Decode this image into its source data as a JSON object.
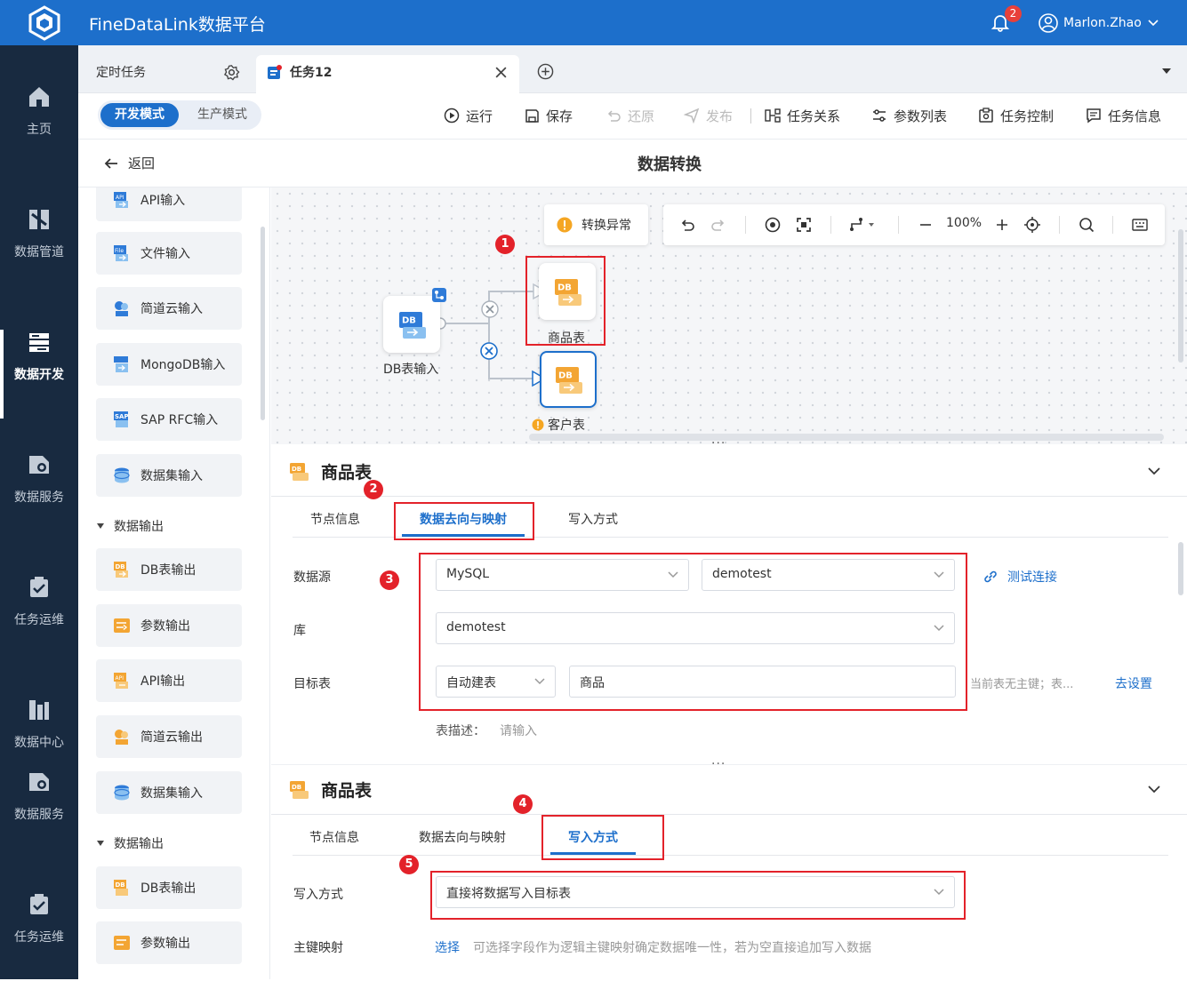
{
  "app": {
    "title": "FineDataLink数据平台",
    "notif_count": "2",
    "user": "Marlon.Zhao"
  },
  "nav": [
    {
      "label": "主页",
      "icon": "home-icon"
    },
    {
      "label": "数据管道",
      "icon": "pipeline-icon"
    },
    {
      "label": "数据开发",
      "icon": "dev-icon"
    },
    {
      "label": "数据服务",
      "icon": "service-icon"
    },
    {
      "label": "任务运维",
      "icon": "ops-icon"
    },
    {
      "label": "数据中心",
      "icon": "center-icon"
    },
    {
      "label": "数据服务",
      "icon": "service-icon"
    },
    {
      "label": "任务运维",
      "icon": "ops-icon"
    }
  ],
  "tabs": {
    "scheduled": "定时任务",
    "task": "任务12"
  },
  "toolbar": {
    "mode_dev": "开发模式",
    "mode_prod": "生产模式",
    "run": "运行",
    "save": "保存",
    "restore": "还原",
    "publish": "发布",
    "relation": "任务关系",
    "params": "参数列表",
    "control": "任务控制",
    "info": "任务信息"
  },
  "header": {
    "back": "返回",
    "title": "数据转换"
  },
  "palette": {
    "items1": [
      "API输入",
      "文件输入",
      "简道云输入",
      "MongoDB输入",
      "SAP RFC输入",
      "数据集输入"
    ],
    "group_output": "数据输出",
    "items2": [
      "DB表输出",
      "参数输出",
      "API输出",
      "简道云输出"
    ],
    "items3": [
      "数据集输入"
    ],
    "items4": [
      "DB表输出",
      "参数输出"
    ]
  },
  "canvas": {
    "exception": "转换异常",
    "zoom": "100%",
    "node_source": "DB表输入",
    "node_product": "商品表",
    "node_customer": "客户表",
    "db_tag": "DB"
  },
  "panel1": {
    "title": "商品表",
    "tabs": [
      "节点信息",
      "数据去向与映射",
      "写入方式"
    ],
    "label_source": "数据源",
    "datasource_type": "MySQL",
    "datasource_conn": "demotest",
    "test_conn": "测试连接",
    "label_db": "库",
    "db": "demotest",
    "label_target": "目标表",
    "create_mode": "自动建表",
    "table_name": "商品",
    "pk_hint": "当前表无主键；表...",
    "go_set": "去设置",
    "desc_label": "表描述：",
    "desc_placeholder": "请输入"
  },
  "panel2": {
    "title": "商品表",
    "tabs": [
      "节点信息",
      "数据去向与映射",
      "写入方式"
    ],
    "label_write": "写入方式",
    "write_mode": "直接将数据写入目标表",
    "label_pk": "主键映射",
    "pk_select": "选择",
    "pk_desc": "可选择字段作为逻辑主键映射确定数据唯一性，若为空直接追加写入数据"
  },
  "markers": [
    "1",
    "2",
    "3",
    "4",
    "5"
  ],
  "colors": {
    "brand": "#1d6fcb",
    "nav_bg": "#182a40",
    "highlight": "#e3222a",
    "db_orange": "#f3a533"
  }
}
